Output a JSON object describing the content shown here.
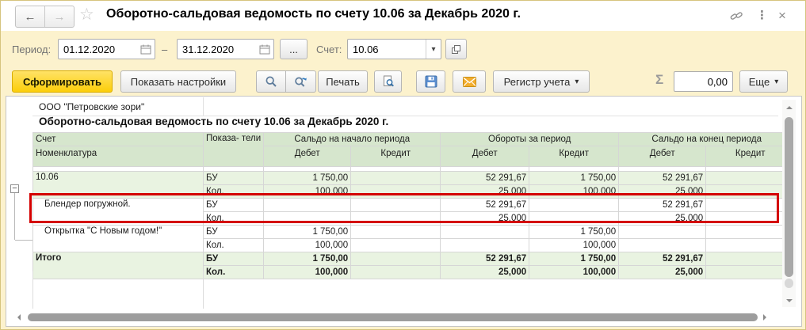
{
  "glyphs": {
    "caret": "▾",
    "ellipsis": "...",
    "collapse": "−"
  },
  "titlebar": {
    "back": "←",
    "forward": "→",
    "favorite_star": "☆",
    "title": "Оборотно-сальдовая ведомость по счету 10.06 за Декабрь 2020 г.",
    "more_dots": "⋮",
    "close": "×"
  },
  "filter": {
    "period_label": "Период:",
    "period_from": "01.12.2020",
    "period_to": "31.12.2020",
    "range_dash": "–",
    "account_label": "Счет:",
    "account_value": "10.06"
  },
  "toolbar": {
    "generate": "Сформировать",
    "show_settings": "Показать настройки",
    "print": "Печать",
    "register": "Регистр учета",
    "sigma": "Σ",
    "sum_value": "0,00",
    "more": "Еще"
  },
  "report": {
    "company": "ООО \"Петровские зори\"",
    "title": "Оборотно-сальдовая ведомость по счету 10.06 за Декабрь 2020 г.",
    "header": {
      "account": "Счет",
      "nomenclature": "Номенклатура",
      "indicators": "Показа-\nтели",
      "opening": "Сальдо на начало периода",
      "turnover": "Обороты за период",
      "closing": "Сальдо на конец периода",
      "debit": "Дебет",
      "credit": "Кредит"
    },
    "rows": [
      {
        "name": "10.06",
        "type": "group",
        "lines": [
          {
            "indicator": "БУ",
            "values": [
              "1 750,00",
              "",
              "52 291,67",
              "1 750,00",
              "52 291,67",
              ""
            ]
          },
          {
            "indicator": "Кол.",
            "values": [
              "100,000",
              "",
              "25,000",
              "100,000",
              "25,000",
              ""
            ]
          }
        ]
      },
      {
        "name": "Блендер погружной.",
        "type": "detail",
        "highlighted": true,
        "lines": [
          {
            "indicator": "БУ",
            "values": [
              "",
              "",
              "52 291,67",
              "",
              "52 291,67",
              ""
            ]
          },
          {
            "indicator": "Кол.",
            "values": [
              "",
              "",
              "25,000",
              "",
              "25,000",
              ""
            ]
          }
        ]
      },
      {
        "name": "Открытка \"С Новым годом!\"",
        "type": "detail",
        "lines": [
          {
            "indicator": "БУ",
            "values": [
              "1 750,00",
              "",
              "",
              "1 750,00",
              "",
              ""
            ]
          },
          {
            "indicator": "Кол.",
            "values": [
              "100,000",
              "",
              "",
              "100,000",
              "",
              ""
            ]
          }
        ]
      },
      {
        "name": "Итого",
        "type": "total",
        "lines": [
          {
            "indicator": "БУ",
            "values": [
              "1 750,00",
              "",
              "52 291,67",
              "1 750,00",
              "52 291,67",
              ""
            ]
          },
          {
            "indicator": "Кол.",
            "values": [
              "100,000",
              "",
              "25,000",
              "100,000",
              "25,000",
              ""
            ]
          }
        ]
      }
    ]
  }
}
